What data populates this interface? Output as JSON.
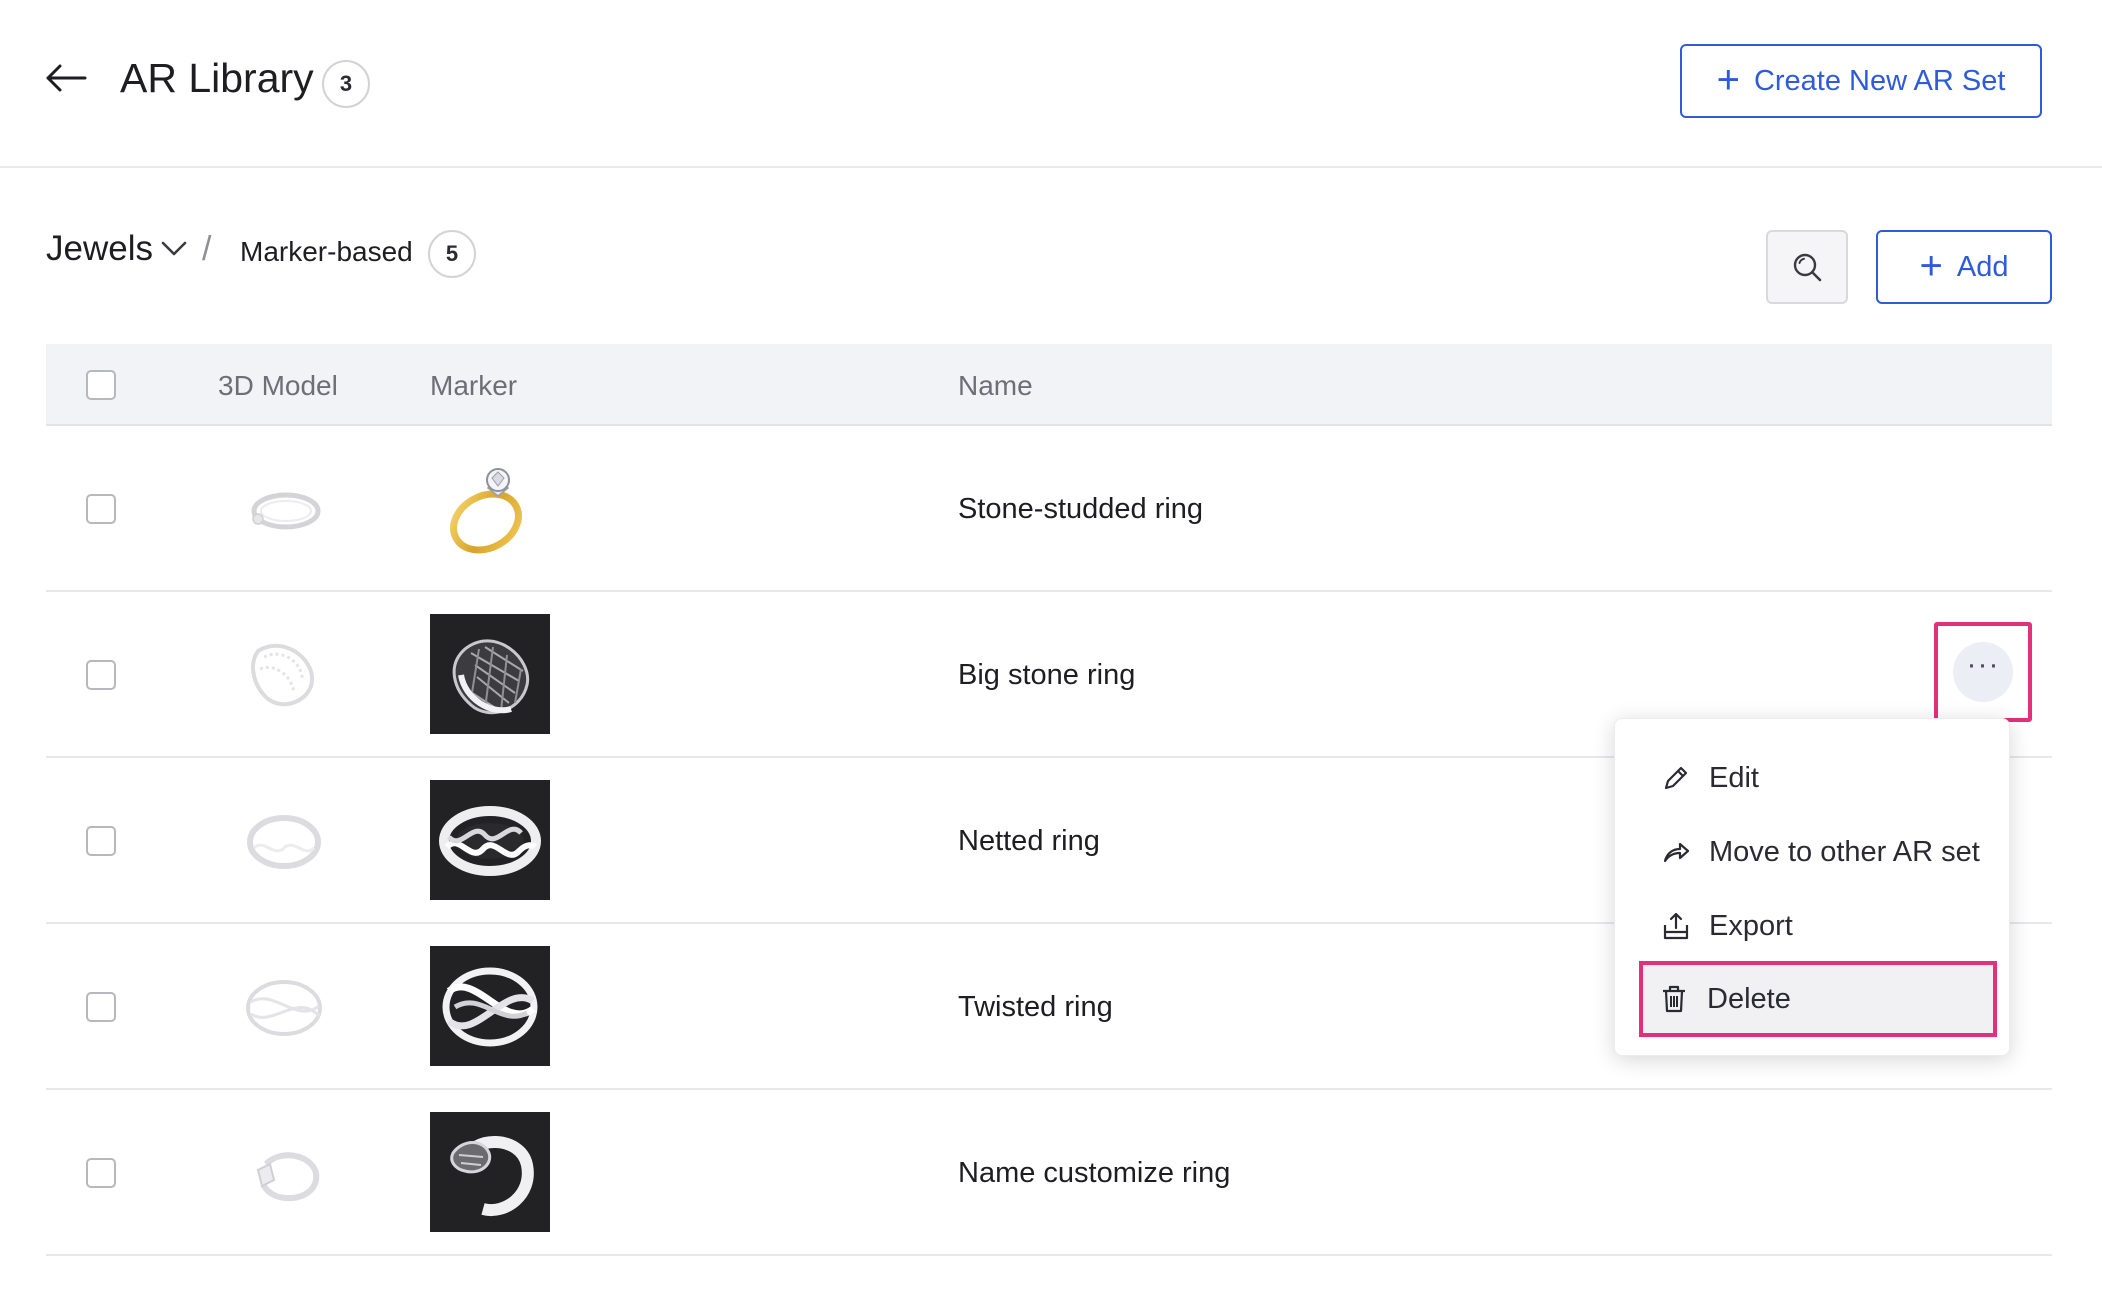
{
  "header": {
    "title": "AR Library",
    "count": "3",
    "create_button_label": "Create New AR Set"
  },
  "breadcrumb": {
    "set_name": "Jewels",
    "separator": "/",
    "type_name": "Marker-based",
    "type_count": "5"
  },
  "toolbar": {
    "add_label": "Add"
  },
  "table": {
    "columns": {
      "model": "3D Model",
      "marker": "Marker",
      "name": "Name"
    },
    "rows": [
      {
        "name": "Stone-studded ring"
      },
      {
        "name": "Big stone ring"
      },
      {
        "name": "Netted ring"
      },
      {
        "name": "Twisted ring"
      },
      {
        "name": "Name customize ring"
      }
    ]
  },
  "row_actions": {
    "more_label": "···"
  },
  "context_menu": {
    "items": [
      {
        "label": "Edit",
        "icon": "pencil-icon"
      },
      {
        "label": "Move to other AR set",
        "icon": "share-arrow-icon"
      },
      {
        "label": "Export",
        "icon": "export-icon"
      },
      {
        "label": "Delete",
        "icon": "trash-icon"
      }
    ]
  },
  "colors": {
    "accent": "#2f5bd8",
    "highlight": "#e2307a"
  }
}
